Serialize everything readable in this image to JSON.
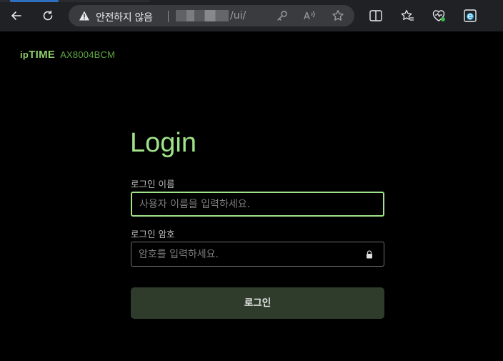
{
  "browser": {
    "security_warning": "안전하지 않음",
    "url_path": "/ui/"
  },
  "header": {
    "brand_prefix": "ip",
    "brand_name": "TIME",
    "model": "AX8004BCM"
  },
  "form": {
    "title": "Login",
    "username_label": "로그인 이름",
    "username_placeholder": "사용자 이름을 입력하세요.",
    "password_label": "로그인 암호",
    "password_placeholder": "암호를 입력하세요.",
    "submit_label": "로그인"
  },
  "colors": {
    "accent": "#9fe38a",
    "brand": "#5fa843",
    "button_bg": "#2f3c2b"
  }
}
